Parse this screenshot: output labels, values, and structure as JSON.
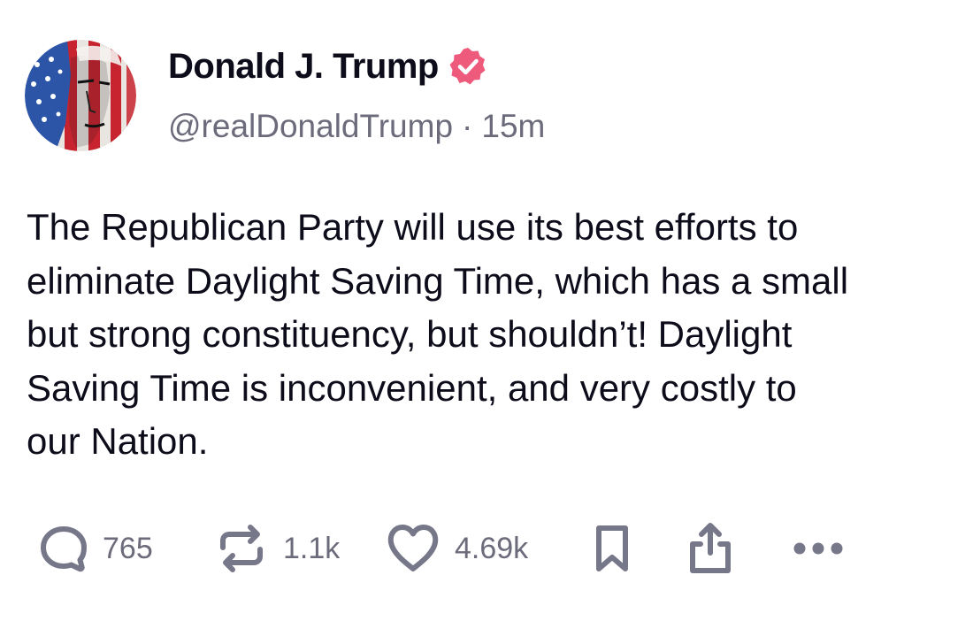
{
  "post": {
    "author": {
      "display_name": "Donald J. Trump",
      "handle": "@realDonaldTrump",
      "verified": true,
      "verified_color": "#ee5a7c"
    },
    "separator": "·",
    "timestamp": "15m",
    "text": "The Republican Party will use its best efforts to\neliminate Daylight Saving Time, which has a small\nbut strong constituency, but shouldn’t! Daylight\nSaving Time is inconvenient, and very costly to\nour Nation."
  },
  "actions": {
    "reply": {
      "icon": "reply-icon",
      "count": "765"
    },
    "repost": {
      "icon": "repost-icon",
      "count": "1.1k"
    },
    "like": {
      "icon": "heart-icon",
      "count": "4.69k"
    },
    "bookmark": {
      "icon": "bookmark-icon"
    },
    "share": {
      "icon": "share-icon"
    },
    "more": {
      "icon": "more-icon"
    }
  },
  "colors": {
    "text": "#0c0c1a",
    "muted": "#6b6b7b",
    "icon": "#77778a"
  }
}
